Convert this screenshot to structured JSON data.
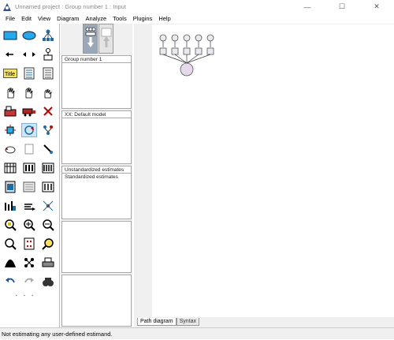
{
  "window": {
    "title": "Unnamed project : Group number 1 : Input",
    "minimize_glyph": "—",
    "maximize_glyph": "☐",
    "close_glyph": "✕"
  },
  "menu": [
    "File",
    "Edit",
    "View",
    "Diagram",
    "Analyze",
    "Tools",
    "Plugins",
    "Help"
  ],
  "toolbox": {
    "tools": [
      {
        "name": "draw-observed-icon"
      },
      {
        "name": "draw-unobserved-icon"
      },
      {
        "name": "draw-indicator-icon"
      },
      {
        "name": "draw-path-icon"
      },
      {
        "name": "draw-covariance-icon"
      },
      {
        "name": "unique-variable-icon"
      },
      {
        "name": "figure-caption-icon",
        "label": "Title"
      },
      {
        "name": "list-variables-icon"
      },
      {
        "name": "list-dataset-icon"
      },
      {
        "name": "select-one-icon"
      },
      {
        "name": "select-all-icon"
      },
      {
        "name": "deselect-all-icon"
      },
      {
        "name": "duplicate-icon"
      },
      {
        "name": "move-icon"
      },
      {
        "name": "erase-icon"
      },
      {
        "name": "change-shape-icon"
      },
      {
        "name": "rotate-indicators-icon"
      },
      {
        "name": "reflect-indicators-icon"
      },
      {
        "name": "move-parameters-icon"
      },
      {
        "name": "scroll-icon"
      },
      {
        "name": "touch-up-icon"
      },
      {
        "name": "data-files-icon"
      },
      {
        "name": "analysis-properties-icon"
      },
      {
        "name": "calculate-estimates-icon"
      },
      {
        "name": "copy-diagram-icon"
      },
      {
        "name": "view-text-icon"
      },
      {
        "name": "save-diagram-icon"
      },
      {
        "name": "object-properties-icon"
      },
      {
        "name": "drag-properties-icon"
      },
      {
        "name": "preserve-symmetries-icon"
      },
      {
        "name": "zoom-select-icon"
      },
      {
        "name": "zoom-in-icon"
      },
      {
        "name": "zoom-out-icon"
      },
      {
        "name": "zoom-page-icon"
      },
      {
        "name": "fit-page-icon"
      },
      {
        "name": "magnify-icon"
      },
      {
        "name": "bayesian-icon"
      },
      {
        "name": "multiple-group-icon"
      },
      {
        "name": "print-icon"
      },
      {
        "name": "undo-icon"
      },
      {
        "name": "redo-icon"
      },
      {
        "name": "spec-search-icon"
      }
    ]
  },
  "panels": {
    "groups": {
      "header": "Group number 1"
    },
    "models": {
      "header": "XX: Default model"
    },
    "estimates": {
      "header": "Unstandardized estimates",
      "line1": "Standardized estimates"
    }
  },
  "tabs": {
    "path": "Path diagram",
    "syntax": "Syntax"
  },
  "status": "Not estimating any user-defined estimand."
}
